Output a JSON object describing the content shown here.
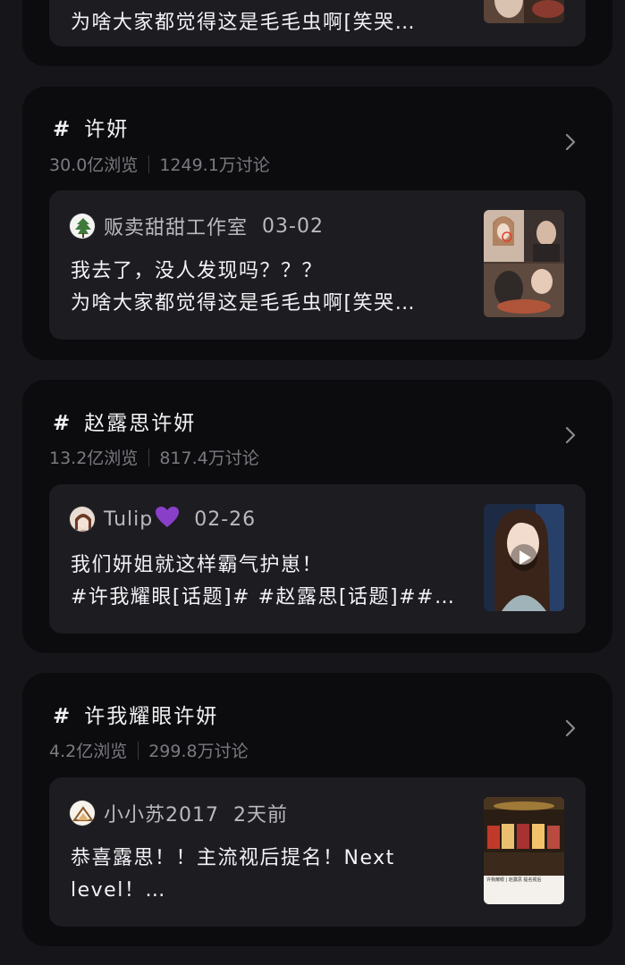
{
  "partial_top": {
    "line": "为啥大家都觉得这是毛毛虫啊[笑哭…"
  },
  "topics": [
    {
      "title": "许妍",
      "views": "30.0亿浏览",
      "discussions": "1249.1万讨论",
      "post": {
        "author": "贩卖甜甜工作室",
        "date": "03-02",
        "line1": "我去了，没人发现吗？？？",
        "line2": "为啥大家都觉得这是毛毛虫啊[笑哭…"
      }
    },
    {
      "title": "赵露思许妍",
      "views": "13.2亿浏览",
      "discussions": "817.4万讨论",
      "post": {
        "author": "Tulip",
        "author_emoji": "💜",
        "date": "02-26",
        "line1": "我们妍姐就这样霸气护崽！",
        "line2": "#许我耀眼[话题]# #赵露思[话题]##…"
      }
    },
    {
      "title": "许我耀眼许妍",
      "views": "4.2亿浏览",
      "discussions": "299.8万讨论",
      "post": {
        "author": "小小苏2017",
        "date": "2天前",
        "line1": "恭喜露思！！主流视后提名！Next",
        "line2": "level！…",
        "thumb_caption": "许我耀眼 | 赵露思 提名视后"
      }
    }
  ],
  "hash_symbol": "#",
  "colors": {
    "page_bg": "#16161a",
    "card_bg": "#0c0c0f",
    "post_bg": "#1c1c21",
    "muted_text": "#7a7a80"
  }
}
